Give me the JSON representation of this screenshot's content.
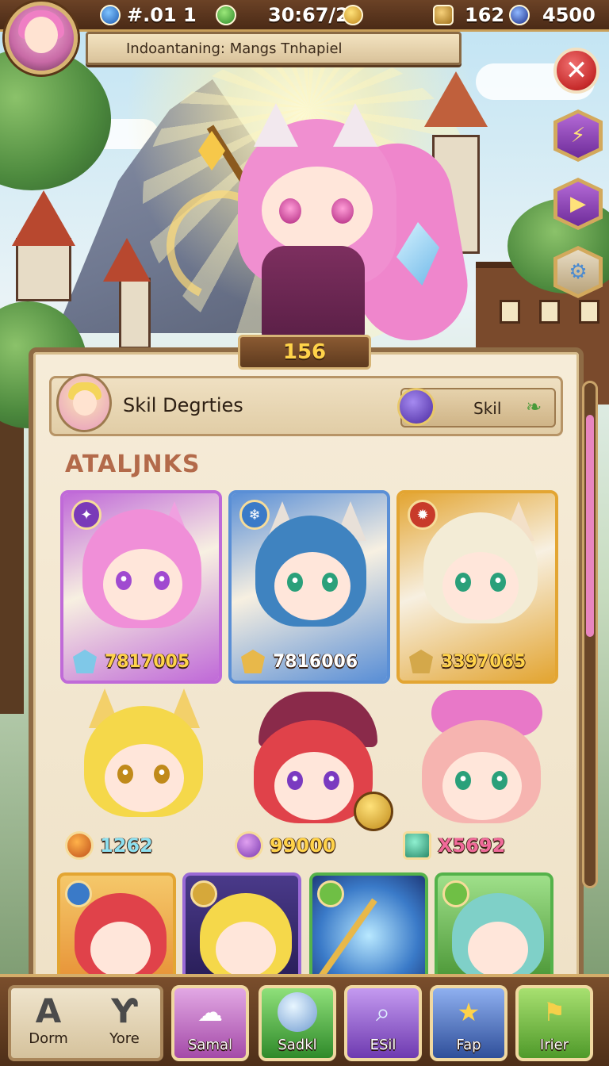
{
  "topbar": {
    "stat1": "#.01 1",
    "stat2": "30:67/2",
    "stat3": "162",
    "stat4": "4500"
  },
  "title_plate": "Indoantaning: Mangs Tnhapiel",
  "side_buttons": {
    "close": "close-icon",
    "b1": "lightning-icon",
    "b2": "play-icon",
    "b3": "gear-icon"
  },
  "panel": {
    "badge": "156",
    "header_title": "Skil Degrties",
    "skill_label": "Skil",
    "section_title": "ATALJNKS"
  },
  "cards": [
    {
      "power": "7817005",
      "theme": "#c06ad8",
      "hair": "#f08fd8",
      "eye": "#a04ad0"
    },
    {
      "power": "7816006",
      "theme": "#5a8fd6",
      "hair": "#3f83c0",
      "eye": "#2aa07a"
    },
    {
      "power": "3397065",
      "theme": "#e3a532",
      "hair": "#f3ecd6",
      "eye": "#2aa07a"
    }
  ],
  "free_heroes": [
    {
      "power": "1262",
      "hair": "#f5d84a",
      "eye": "#c08a1a",
      "valcolor": "#8de0f0"
    },
    {
      "power": "99000",
      "hair": "#e0424a",
      "eye": "#7a3ac0",
      "valcolor": "#ffd34a"
    },
    {
      "power": "X5692",
      "hair": "#f6b4b0",
      "eye": "#2aa07a",
      "valcolor": "#f06a9a"
    }
  ],
  "bottom_nav": {
    "dorm": "Dorm",
    "yore": "Yore",
    "items": [
      {
        "label": "Samal",
        "icon": "cloud-creature-icon",
        "color": "#c77fc9"
      },
      {
        "label": "Sadkl",
        "icon": "orb-icon",
        "color": "#54b24a"
      },
      {
        "label": "ESil",
        "icon": "search-icon",
        "color": "#9a6ad6"
      },
      {
        "label": "Fap",
        "icon": "star-icon",
        "color": "#4f7fd0"
      },
      {
        "label": "Irier",
        "icon": "banner-icon",
        "color": "#6fbf45"
      }
    ]
  }
}
